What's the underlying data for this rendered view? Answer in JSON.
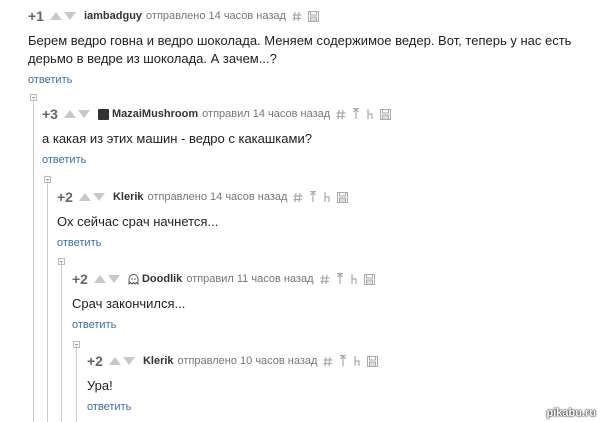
{
  "comments": [
    {
      "rating": "+1",
      "author": "iambadguy",
      "meta": "отправлено 14 часов назад",
      "text": "Берем ведро говна и ведро шоколада. Меняем содержимое ведер. Вот, теперь у нас есть дерьмо в ведре из шоколада. А зачем...?",
      "reply": "ответить",
      "avatar": "none"
    },
    {
      "rating": "+3",
      "author": "MazaiMushroom",
      "meta": "отправил 14 часов назад",
      "text": "а какая из этих машин - ведро с какашками?",
      "reply": "ответить",
      "avatar": "photo"
    },
    {
      "rating": "+2",
      "author": "Klerik",
      "meta": "отправлено 14 часов назад",
      "text": "Ох сейчас срач начнется...",
      "reply": "ответить",
      "avatar": "none"
    },
    {
      "rating": "+2",
      "author": "Doodlik",
      "meta": "отправил 11 часов назад",
      "text": "Срач закончился...",
      "reply": "ответить",
      "avatar": "ghost"
    },
    {
      "rating": "+2",
      "author": "Klerik",
      "meta": "отправлено 10 часов назад",
      "text": "Ура!",
      "reply": "ответить",
      "avatar": "none"
    }
  ],
  "icons": [
    "arrow-up-icon",
    "arrow-down-icon",
    "hash-link-icon",
    "save-icon",
    "parent-link-icon",
    "branch-icon",
    "collapse-icon"
  ],
  "colors": {
    "link": "#3b6ea5",
    "text": "#222222",
    "meta": "#777777",
    "lines": "#cccccc"
  },
  "watermark": "pikabu.ru"
}
